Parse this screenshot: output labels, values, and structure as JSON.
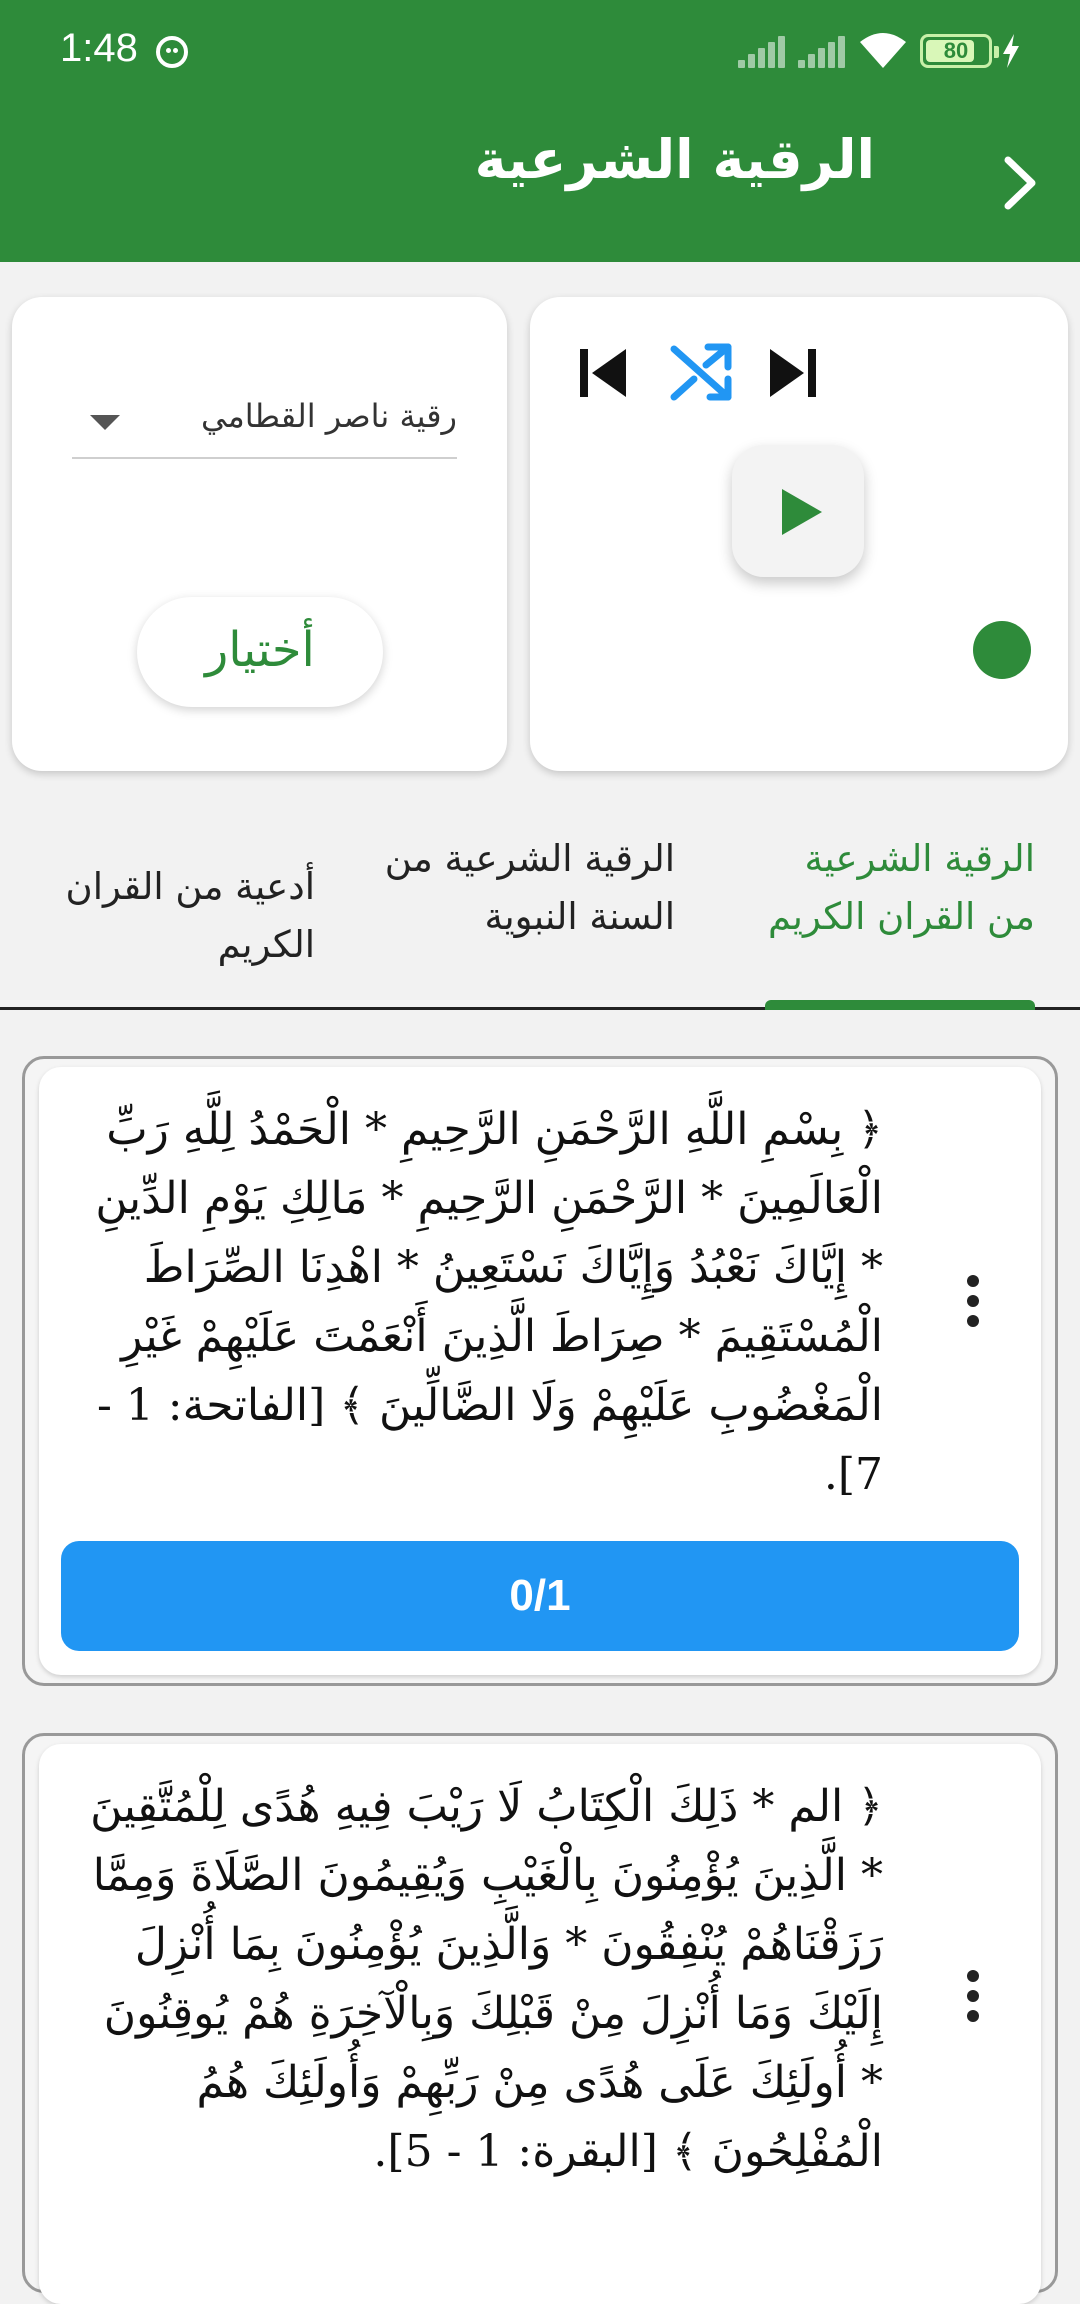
{
  "status_bar": {
    "time": "1:48",
    "battery": "80",
    "battery_level": 0.8
  },
  "app_bar": {
    "title": "الرقية الشرعية"
  },
  "player": {
    "controls": [
      "shuffle-icon",
      "skip-next-icon",
      "skip-previous-icon",
      "play-icon"
    ],
    "accent": "#2e8b3a"
  },
  "selector": {
    "selected": "رقية ناصر القطامي",
    "choose_label": "أختيار"
  },
  "tabs": [
    {
      "label": "الرقية الشرعية من القران الكريم",
      "active": true
    },
    {
      "label": "الرقية الشرعية من السنة النبوية",
      "active": false
    },
    {
      "label": "أدعية من القران الكريم",
      "active": false
    }
  ],
  "items": [
    {
      "text": "﴿ بِسْمِ اللَّهِ الرَّحْمَنِ الرَّحِيمِ * الْحَمْدُ لِلَّهِ رَبِّ الْعَالَمِينَ * الرَّحْمَنِ الرَّحِيمِ * مَالِكِ يَوْمِ الدِّينِ * إِيَّاكَ نَعْبُدُ وَإِيَّاكَ نَسْتَعِينُ * اهْدِنَا الصِّرَاطَ الْمُسْتَقِيمَ * صِرَاطَ الَّذِينَ أَنْعَمْتَ عَلَيْهِمْ غَيْرِ الْمَغْضُوبِ عَلَيْهِمْ وَلَا الضَّالِّينَ ﴾ [الفاتحة: 1 - 7].",
      "counter": "0/1"
    },
    {
      "text": "﴿ الم * ذَلِكَ الْكِتَابُ لَا رَيْبَ فِيهِ هُدًى لِلْمُتَّقِينَ * الَّذِينَ يُؤْمِنُونَ بِالْغَيْبِ وَيُقِيمُونَ الصَّلَاةَ وَمِمَّا رَزَقْنَاهُمْ يُنْفِقُونَ * وَالَّذِينَ يُؤْمِنُونَ بِمَا أُنْزِلَ إِلَيْكَ وَمَا أُنْزِلَ مِنْ قَبْلِكَ وَبِالْآخِرَةِ هُمْ يُوقِنُونَ * أُولَئِكَ عَلَى هُدًى مِنْ رَبِّهِمْ وَأُولَئِكَ هُمُ الْمُفْلِحُونَ ﴾ [البقرة: 1 - 5]."
    }
  ]
}
